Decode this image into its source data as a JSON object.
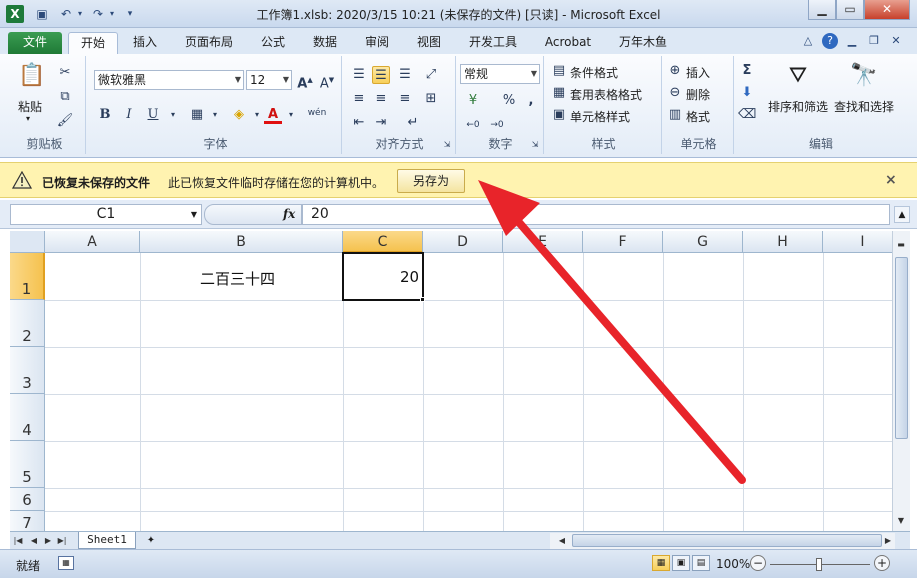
{
  "window": {
    "title": "工作簿1.xlsb: 2020/3/15 10:21 (未保存的文件) [只读] - Microsoft Excel",
    "logo": "X"
  },
  "ribbon": {
    "tabs": [
      "文件",
      "开始",
      "插入",
      "页面布局",
      "公式",
      "数据",
      "审阅",
      "视图",
      "开发工具",
      "Acrobat",
      "万年木鱼"
    ],
    "active_tab": "开始",
    "groups": {
      "clipboard": {
        "label": "剪贴板",
        "paste": "粘贴"
      },
      "font": {
        "label": "字体",
        "font_name": "微软雅黑",
        "font_size": "12",
        "bold": "B",
        "italic": "I",
        "underline": "U",
        "wen": "wén"
      },
      "alignment": {
        "label": "对齐方式"
      },
      "number": {
        "label": "数字",
        "format": "常规",
        "percent": "%",
        "comma": ","
      },
      "styles": {
        "label": "样式",
        "conditional": "条件格式",
        "table": "套用表格格式",
        "cell_styles": "单元格样式"
      },
      "cells": {
        "label": "单元格",
        "insert": "插入",
        "delete": "删除",
        "format": "格式"
      },
      "editing": {
        "label": "编辑",
        "sum": "Σ",
        "sort": "排序和筛选",
        "find": "查找和选择"
      }
    }
  },
  "infobar": {
    "title": "已恢复未保存的文件",
    "message": "此已恢复文件临时存储在您的计算机中。",
    "save_as": "另存为",
    "close": "×"
  },
  "formula": {
    "name_box": "C1",
    "fx": "fx",
    "value": "20"
  },
  "grid": {
    "columns": [
      "A",
      "B",
      "C",
      "D",
      "E",
      "F",
      "G",
      "H",
      "I"
    ],
    "rows": [
      "1",
      "2",
      "3",
      "4",
      "5",
      "6",
      "7"
    ],
    "active_column": "C",
    "active_row": "1",
    "cells": {
      "B1": "二百三十四",
      "C1": "20"
    }
  },
  "sheets": {
    "tabs": [
      "Sheet1"
    ]
  },
  "status": {
    "ready": "就绪",
    "zoom": "100%"
  },
  "colors": {
    "accent_file_tab": "#1f7a36",
    "infobar_bg": "#fff3b0",
    "selection_header": "#f5c24f",
    "annotation_arrow": "#e8242a"
  }
}
